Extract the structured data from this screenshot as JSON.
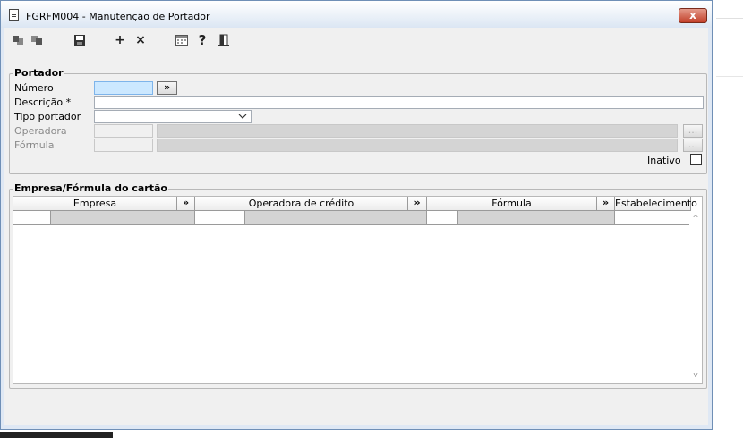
{
  "window": {
    "title": "FGRFM004 - Manutenção de Portador",
    "close_label": "x"
  },
  "toolbar": {
    "items": [
      {
        "name": "first-record-icon"
      },
      {
        "name": "last-record-icon"
      },
      {
        "name": "save-icon"
      },
      {
        "name": "add-icon",
        "label": "+"
      },
      {
        "name": "delete-icon",
        "label": "×"
      },
      {
        "name": "calendar-icon"
      },
      {
        "name": "help-icon",
        "label": "?"
      },
      {
        "name": "exit-icon"
      }
    ]
  },
  "portador": {
    "legend": "Portador",
    "numero_label": "Número",
    "numero_value": "",
    "numero_button": "»",
    "descricao_label": "Descrição *",
    "descricao_value": "",
    "tipo_label": "Tipo portador",
    "tipo_value": "",
    "operadora_label": "Operadora",
    "formula_label": "Fórmula",
    "lookup_button": "...",
    "inativo_label": "Inativo",
    "inativo_checked": false
  },
  "empresa": {
    "legend": "Empresa/Fórmula do cartão",
    "columns": {
      "empresa": "Empresa",
      "operadora": "Operadora de crédito",
      "formula": "Fórmula",
      "estabelecimento": "Estabelecimento"
    },
    "header_button": "»",
    "scroll_up": "^",
    "scroll_down": "v"
  },
  "colors": {
    "title_bg": "#dbe6f3",
    "close_red": "#c2402a",
    "focus_blue": "#cce8ff",
    "client_bg": "#f0f0f0"
  }
}
